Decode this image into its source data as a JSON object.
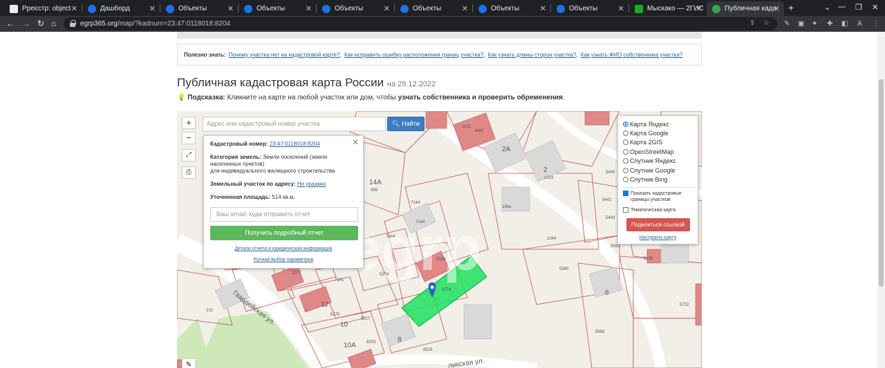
{
  "tabs": [
    {
      "title": "Рреєстр: object",
      "icon": "grid-icon"
    },
    {
      "title": "Дашборд",
      "icon": "globe-icon"
    },
    {
      "title": "Объекты",
      "icon": "globe-icon"
    },
    {
      "title": "Объекты",
      "icon": "globe-icon"
    },
    {
      "title": "Объекты",
      "icon": "globe-icon"
    },
    {
      "title": "Объекты",
      "icon": "globe-icon"
    },
    {
      "title": "Объекты",
      "icon": "globe-icon"
    },
    {
      "title": "Объекты",
      "icon": "globe-icon"
    },
    {
      "title": "Мыскако — 2ГИС",
      "icon": "2gis-icon"
    },
    {
      "title": "Публичная када",
      "icon": "check-icon"
    }
  ],
  "address": {
    "host": "egrp365.org",
    "path": "/map/?kadnum=23:47:0118018:8204"
  },
  "useful": {
    "label": "Полезно знать:",
    "links": [
      "Почему участка нет на кадастровой карте?",
      "Как исправить ошибку расположения границ участка?",
      "Как узнать длины сторон участка?",
      "Как узнать ФИО собственника участка?"
    ]
  },
  "page": {
    "title": "Публичная кадастровая карта России",
    "date": "на 29.12.2022"
  },
  "hint": {
    "label": "Подсказка:",
    "text": "Кликните на карте на любой участок или дом, чтобы",
    "bold": "узнать собственника и проверить обременения",
    "end": "."
  },
  "map": {
    "zoom_in": "+",
    "zoom_out": "−",
    "search_placeholder": "Адрес или кадастровый номер участка",
    "search_button": "Найти",
    "watermark": "egrp",
    "labels": [
      "1192",
      "4660",
      "2А",
      "2",
      "1033",
      "5445",
      "5442",
      "5443",
      "5582",
      "5580",
      "1344",
      "134a",
      "6196",
      "5732",
      "6",
      "5683",
      "7144",
      "7144",
      "7144",
      "14А",
      "999",
      "5526",
      "5274",
      "5527",
      "12",
      "7141",
      "6275",
      "10",
      "10А",
      "8203",
      "8",
      "8319",
      "3077",
      "6274",
      "212",
      "Гвардейская ул.",
      "ликская ул."
    ],
    "popup": {
      "cad_label": "Кадастровый номер:",
      "cad_value": "23:47:0118018:8204",
      "cat_label": "Категория земель:",
      "cat_value": "Земли поселений (земли населенных пунктов)",
      "use_value": "для индивидуального жилищного строительства",
      "addr_label": "Земельный участок по адресу:",
      "addr_value": "Не указано",
      "area_label": "Уточненная площадь:",
      "area_value": "514 кв.м.",
      "email_placeholder": "Ваш email, куда отправить отчет",
      "get_button": "Получить подробный отчет",
      "details_link": "Детали отчета и юридическая информация",
      "manual_link": "Ручной выбор параметров"
    },
    "layers": {
      "options": [
        "Карта Яндекс",
        "Карта Google",
        "Карта 2GIS",
        "OpenStreetMap",
        "Спутник Яндекс",
        "Спутник Google",
        "Спутник Bing"
      ],
      "selected": "Карта Яндекс",
      "show_borders": "Показать кадастровые границы участков",
      "thematic": "Тематическая карта",
      "share_button": "Поделиться ссылкой",
      "configure_link": "Настроить карту"
    }
  }
}
